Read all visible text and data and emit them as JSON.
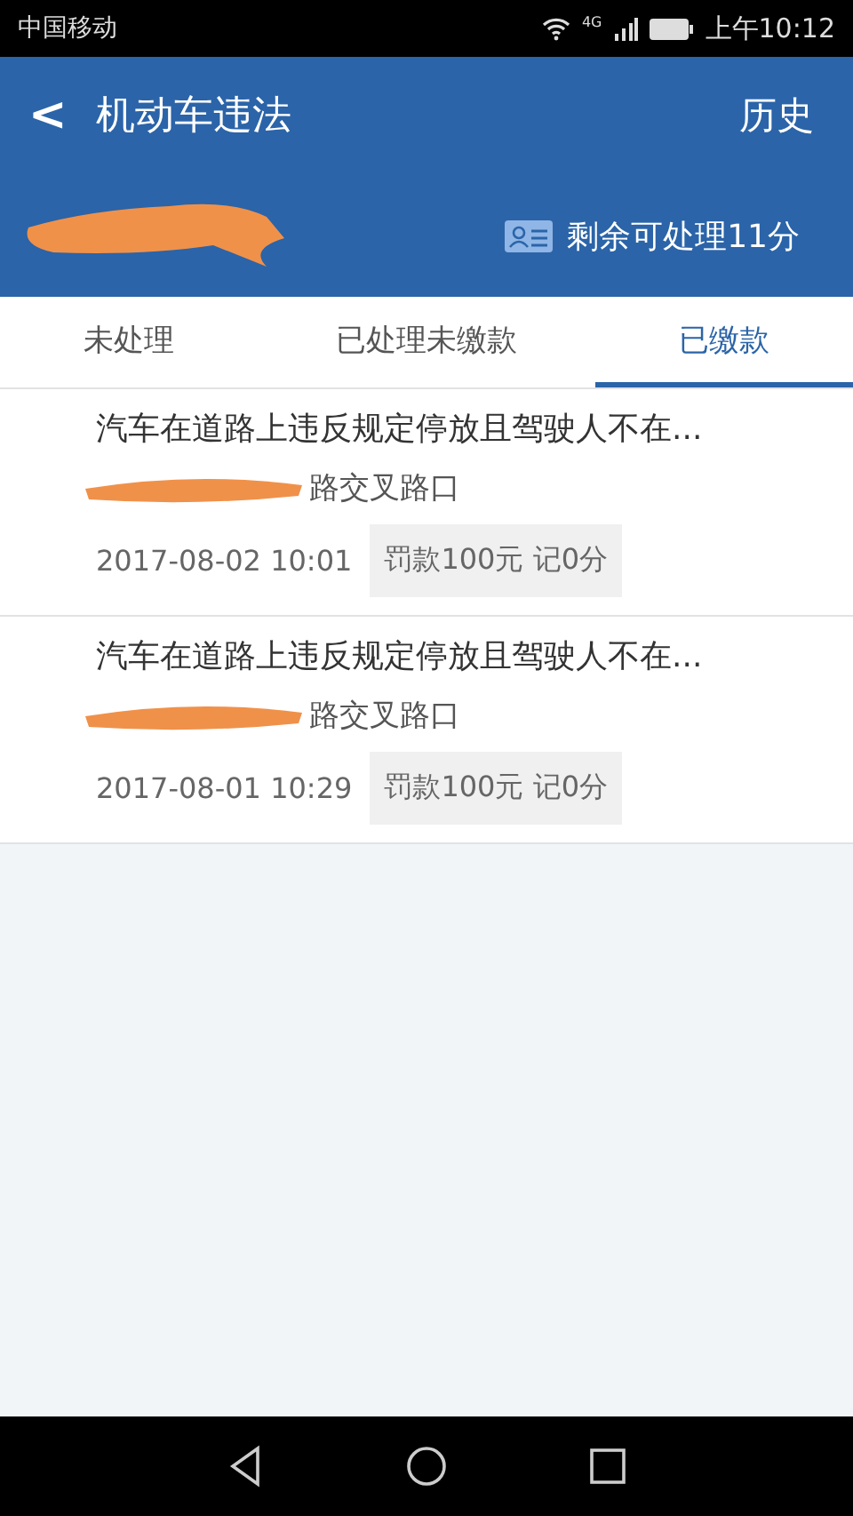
{
  "status_bar": {
    "carrier": "中国移动",
    "network": "4G",
    "time": "上午10:12"
  },
  "header": {
    "back": "<",
    "title": "机动车违法",
    "action": "历史",
    "points_remaining": "剩余可处理11分"
  },
  "tabs": [
    {
      "label": "未处理",
      "selected": false
    },
    {
      "label": "已处理未缴款",
      "selected": false
    },
    {
      "label": "已缴款",
      "selected": true
    }
  ],
  "violations": [
    {
      "description": "汽车在道路上违反规定停放且驾驶人不在...",
      "location": "路交叉路口",
      "time": "2017-08-02 10:01",
      "penalty": "罚款100元 记0分"
    },
    {
      "description": "汽车在道路上违反规定停放且驾驶人不在...",
      "location": "路交叉路口",
      "time": "2017-08-01 10:29",
      "penalty": "罚款100元 记0分"
    }
  ]
}
